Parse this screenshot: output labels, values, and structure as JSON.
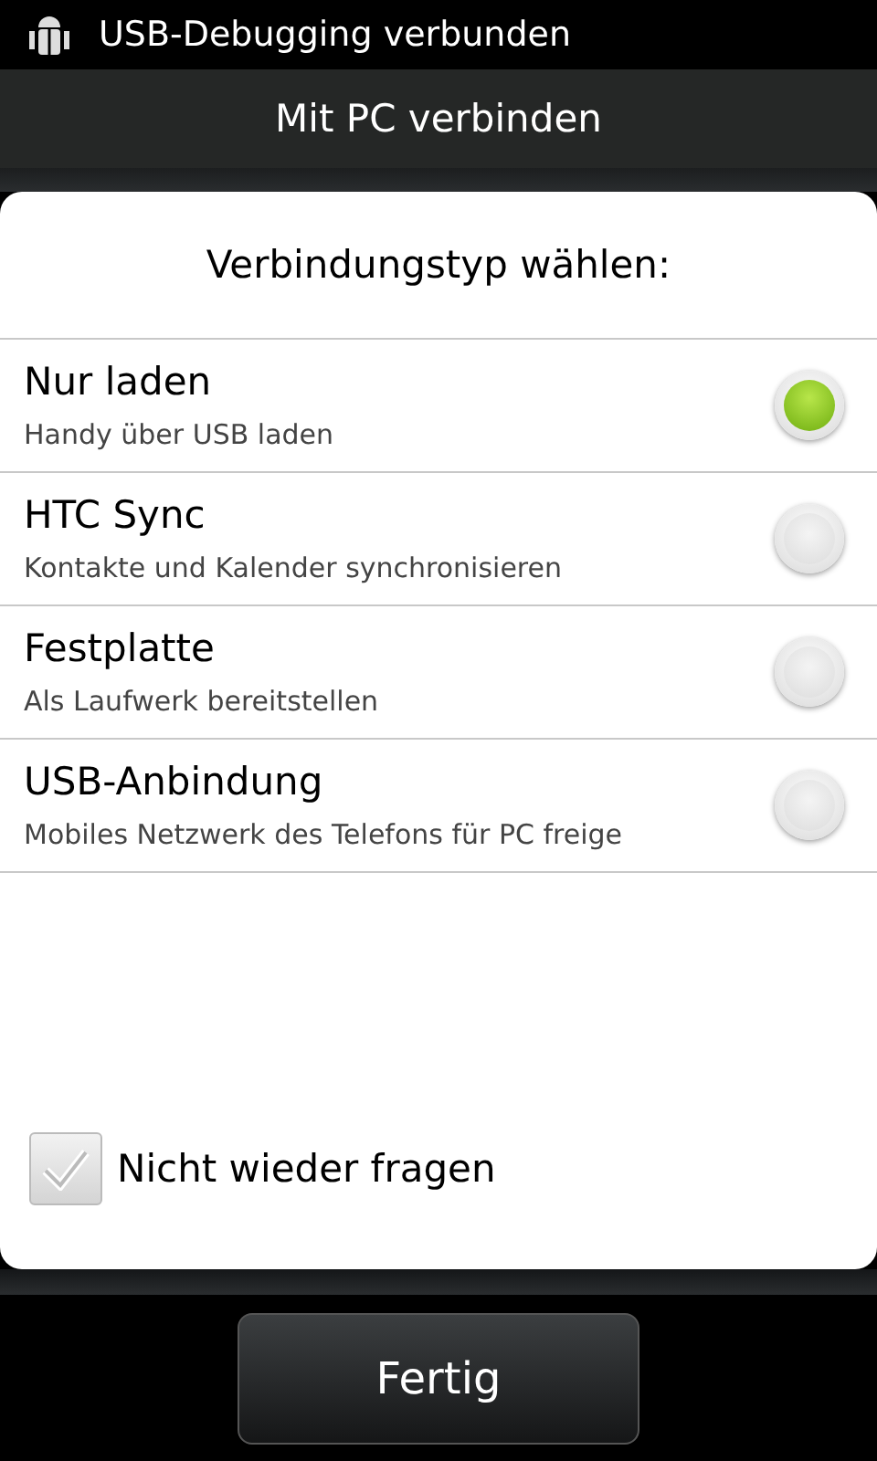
{
  "status_bar": {
    "notification": "USB-Debugging verbunden"
  },
  "title_bar": {
    "title": "Mit PC verbinden"
  },
  "dialog": {
    "heading": "Verbindungstyp wählen:",
    "options": [
      {
        "title": "Nur laden",
        "subtitle": "Handy über USB laden",
        "selected": true
      },
      {
        "title": "HTC Sync",
        "subtitle": "Kontakte und Kalender synchronisieren",
        "selected": false
      },
      {
        "title": "Festplatte",
        "subtitle": "Als Laufwerk bereitstellen",
        "selected": false
      },
      {
        "title": "USB-Anbindung",
        "subtitle": "Mobiles Netzwerk des Telefons für PC freige",
        "selected": false
      }
    ],
    "checkbox": {
      "label": "Nicht wieder fragen",
      "checked": true
    }
  },
  "buttons": [
    "Fertig"
  ]
}
